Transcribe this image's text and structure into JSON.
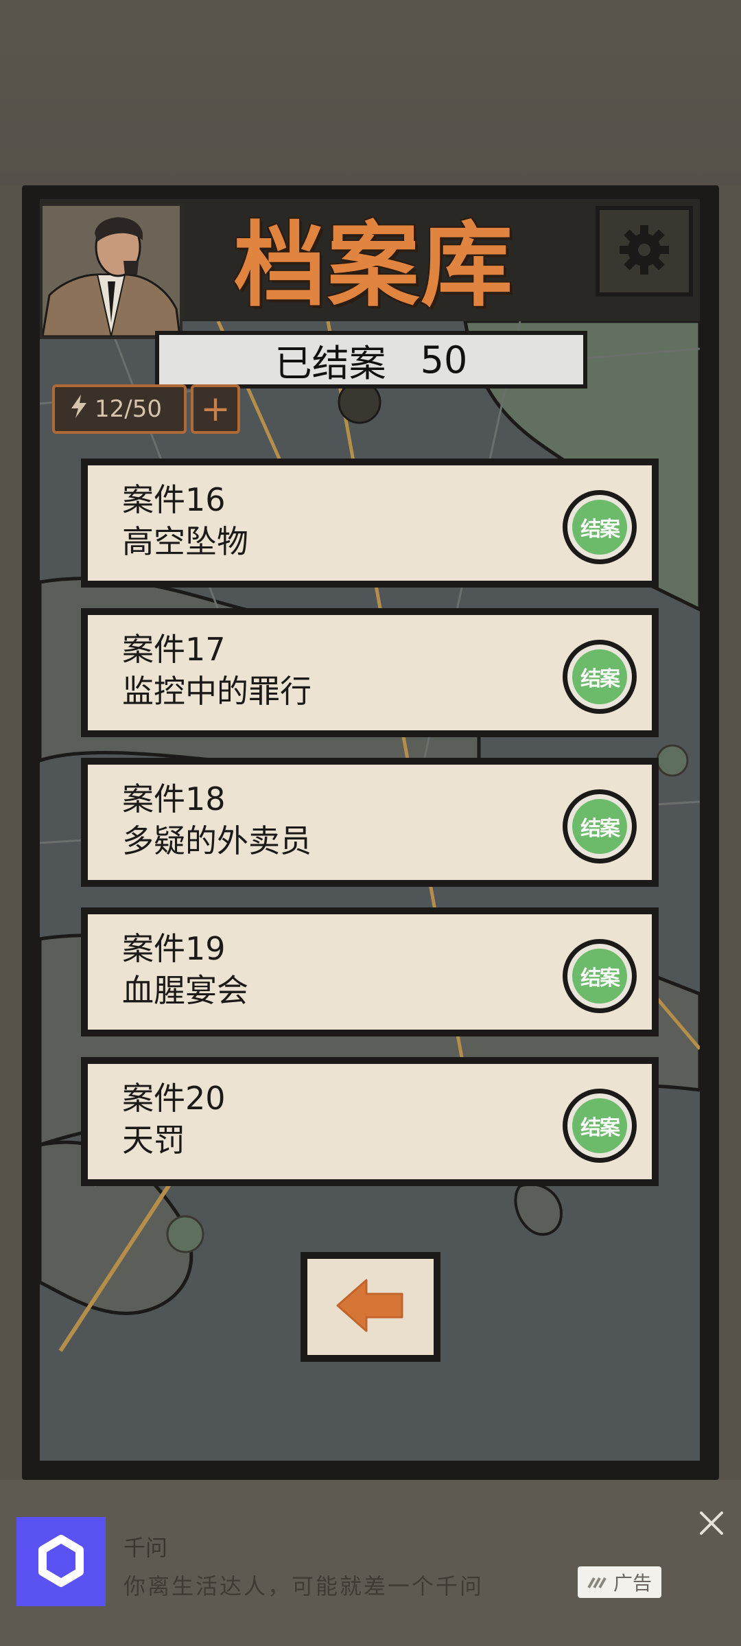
{
  "header": {
    "title": "档案库",
    "closed_label": "已结案",
    "closed_count": "50"
  },
  "energy": {
    "value": "12/50",
    "plus_label": "+"
  },
  "cases": [
    {
      "number": "案件16",
      "name": "高空坠物",
      "stamp": "结案"
    },
    {
      "number": "案件17",
      "name": "监控中的罪行",
      "stamp": "结案"
    },
    {
      "number": "案件18",
      "name": "多疑的外卖员",
      "stamp": "结案"
    },
    {
      "number": "案件19",
      "name": "血腥宴会",
      "stamp": "结案"
    },
    {
      "number": "案件20",
      "name": "天罚",
      "stamp": "结案"
    }
  ],
  "ad": {
    "app_name": "千问",
    "text": "你离生活达人，可能就差一个千问",
    "badge": "广告"
  },
  "icons": {
    "settings": "gear-icon",
    "back": "arrow-left-icon",
    "energy": "lightning-icon",
    "close": "close-icon"
  },
  "colors": {
    "title": "#e0843f",
    "stamp": "#6cbb6a",
    "card": "#ece3d3",
    "ad_logo": "#5b52f4"
  }
}
